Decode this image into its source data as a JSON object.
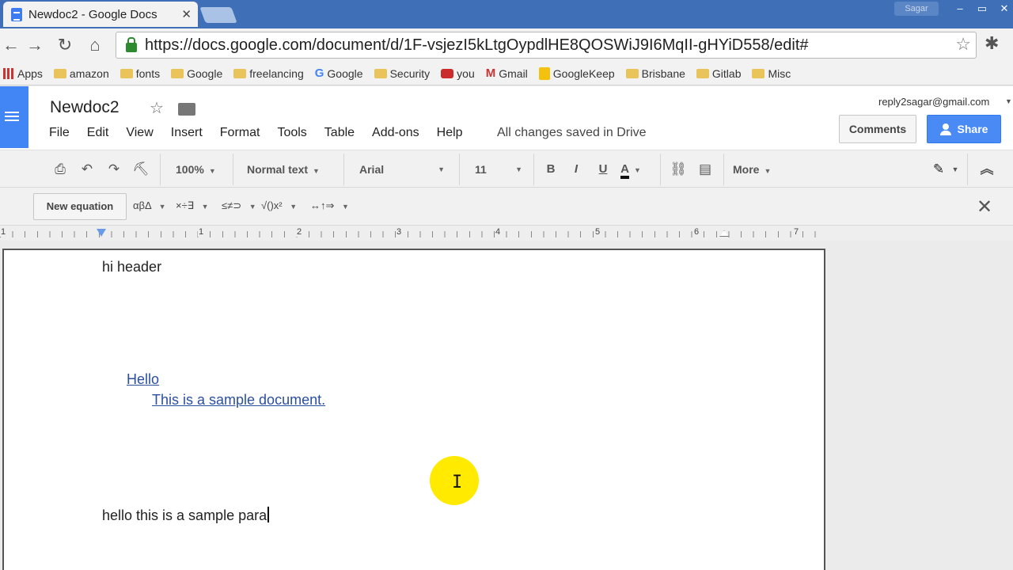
{
  "browser": {
    "tab_title": "Newdoc2 - Google Docs",
    "tab_close": "✕",
    "profile_name": "Sagar",
    "window_controls": [
      "–",
      "▭",
      "✕"
    ],
    "url": "https://docs.google.com/document/d/1F-vsjezI5kLtgOypdlHE8QOSWiJ9I6MqII-gHYiD558/edit#",
    "bookmarks": [
      "Apps",
      "amazon",
      "fonts",
      "Google",
      "freelancing",
      "Google",
      "Security",
      "you",
      "Gmail",
      "GoogleKeep",
      "Brisbane",
      "Gitlab",
      "Misc"
    ]
  },
  "docs": {
    "title": "Newdoc2",
    "menu": [
      "File",
      "Edit",
      "View",
      "Insert",
      "Format",
      "Tools",
      "Table",
      "Add-ons",
      "Help"
    ],
    "save_status": "All changes saved in Drive",
    "account": "reply2sagar@gmail.com",
    "comments_label": "Comments",
    "share_label": "Share"
  },
  "toolbar": {
    "zoom": "100%",
    "style": "Normal text",
    "font": "Arial",
    "size": "11",
    "bold": "B",
    "italic": "I",
    "underline": "U",
    "text_color": "A",
    "more": "More"
  },
  "equation_bar": {
    "new_equation": "New equation",
    "groups": [
      "αβΔ",
      "×÷∃",
      "≤≠⊃",
      "√()x²",
      "↔↑⇒"
    ]
  },
  "ruler": {
    "labels": [
      "1",
      "1",
      "2",
      "3",
      "4",
      "5",
      "6",
      "7"
    ]
  },
  "document": {
    "header_text": "hi header",
    "toc_level1": "Hello",
    "toc_level2": "This is a sample document.",
    "paragraph": "hello this is a sample para"
  },
  "colors": {
    "tabstrip": "#3f6fb6",
    "docs_blue": "#4285f4",
    "share_blue": "#4a8af4",
    "link": "#2a4f9e",
    "cursor_highlight": "#ffea00"
  }
}
